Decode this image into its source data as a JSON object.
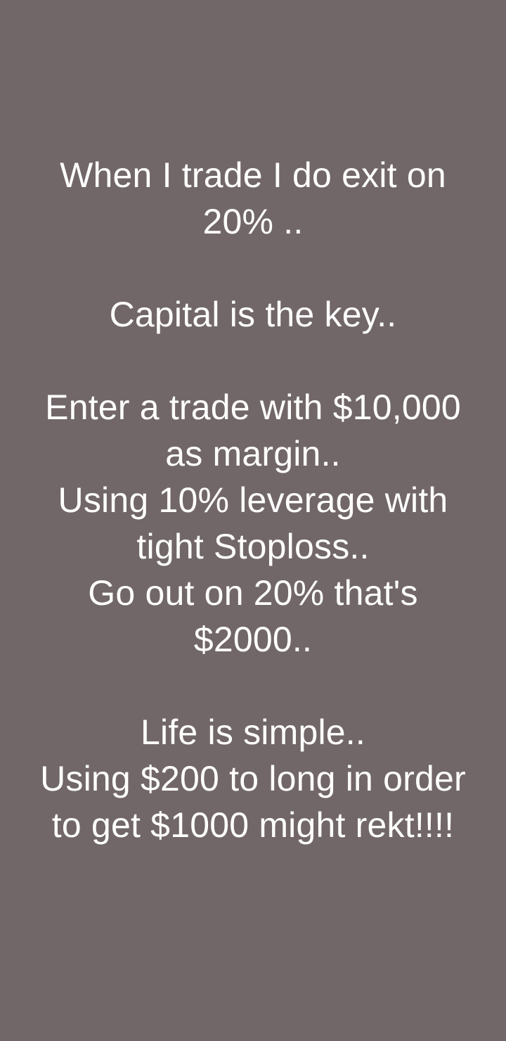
{
  "post": {
    "background_color": "#726768",
    "text_color": "#ffffff",
    "paragraphs": [
      {
        "lines": [
          "When I trade I do exit on",
          "20% .."
        ]
      },
      {
        "lines": [
          "Capital is the key.."
        ]
      },
      {
        "lines": [
          "Enter a trade with $10,000",
          "as margin..",
          "Using 10% leverage with",
          "tight Stoploss..",
          "Go out on 20% that's",
          "$2000.."
        ]
      },
      {
        "lines": [
          "Life is simple..",
          "Using $200 to long in order",
          "to get $1000 might rekt!!!!"
        ]
      }
    ]
  }
}
